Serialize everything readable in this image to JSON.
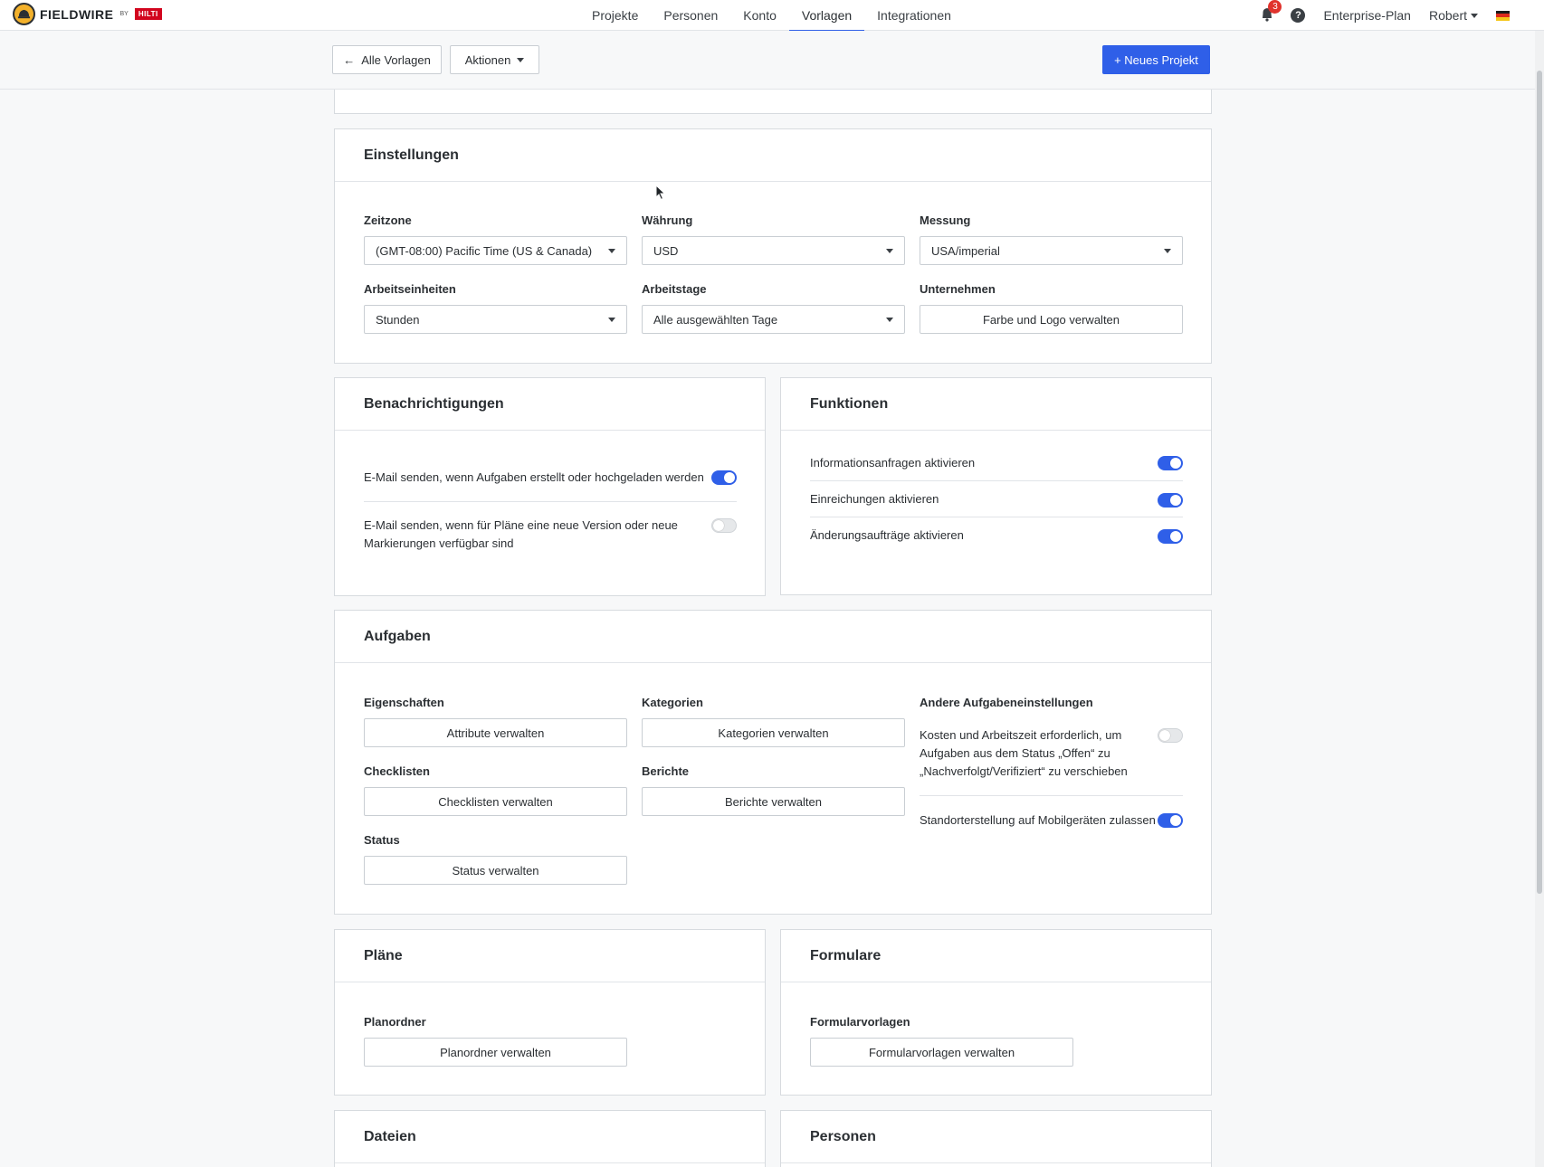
{
  "brand": {
    "name": "FIELDWIRE",
    "by": "BY",
    "partner": "HILTI"
  },
  "nav": {
    "links": [
      "Projekte",
      "Personen",
      "Konto",
      "Vorlagen",
      "Integrationen"
    ],
    "active": "Vorlagen",
    "notifications_count": "3",
    "help_glyph": "?",
    "plan": "Enterprise-Plan",
    "user": "Robert",
    "language_flag": "flag-de-icon"
  },
  "toolbar": {
    "back_label": "Alle Vorlagen",
    "actions_label": "Aktionen",
    "new_project_label": "+ Neues Projekt"
  },
  "settings": {
    "title": "Einstellungen",
    "timezone_label": "Zeitzone",
    "timezone_value": "(GMT-08:00) Pacific Time (US & Canada)",
    "currency_label": "Währung",
    "currency_value": "USD",
    "measure_label": "Messung",
    "measure_value": "USA/imperial",
    "work_units_label": "Arbeitseinheiten",
    "work_units_value": "Stunden",
    "work_days_label": "Arbeitstage",
    "work_days_value": "Alle ausgewählten Tage",
    "company_label": "Unternehmen",
    "company_button": "Farbe und Logo verwalten"
  },
  "notifications": {
    "title": "Benachrichtigungen",
    "items": [
      {
        "text": "E-Mail senden, wenn Aufgaben erstellt oder hochgeladen werden",
        "enabled": true
      },
      {
        "text_line1": "E-Mail senden, wenn für Pläne eine neue Version oder neue",
        "text_line2": "Markierungen verfügbar sind",
        "enabled": false
      }
    ]
  },
  "features": {
    "title": "Funktionen",
    "items": [
      {
        "text": "Informationsanfragen aktivieren",
        "enabled": true
      },
      {
        "text": "Einreichungen aktivieren",
        "enabled": true
      },
      {
        "text": "Änderungsaufträge aktivieren",
        "enabled": true
      }
    ]
  },
  "tasks": {
    "title": "Aufgaben",
    "properties_label": "Eigenschaften",
    "properties_button": "Attribute verwalten",
    "categories_label": "Kategorien",
    "categories_button": "Kategorien verwalten",
    "checklists_label": "Checklisten",
    "checklists_button": "Checklisten verwalten",
    "reports_label": "Berichte",
    "reports_button": "Berichte verwalten",
    "status_label": "Status",
    "status_button": "Status verwalten",
    "other_label": "Andere Aufgabeneinstellungen",
    "cost_line1": "Kosten und Arbeitszeit erforderlich, um",
    "cost_line2": "Aufgaben aus dem Status „Offen“ zu",
    "cost_line3": "„Nachverfolgt/Verifiziert“ zu verschieben",
    "cost_enabled": false,
    "mobile_location": "Standorterstellung auf Mobilgeräten zulassen",
    "mobile_location_enabled": true
  },
  "plans": {
    "title": "Pläne",
    "folder_label": "Planordner",
    "folder_button": "Planordner verwalten"
  },
  "forms": {
    "title": "Formulare",
    "templates_label": "Formularvorlagen",
    "templates_button": "Formularvorlagen verwalten"
  },
  "files": {
    "title": "Dateien"
  },
  "people": {
    "title": "Personen"
  },
  "colors": {
    "accent": "#2f5fe8",
    "badge": "#e0332d",
    "hilti": "#d2051e"
  }
}
